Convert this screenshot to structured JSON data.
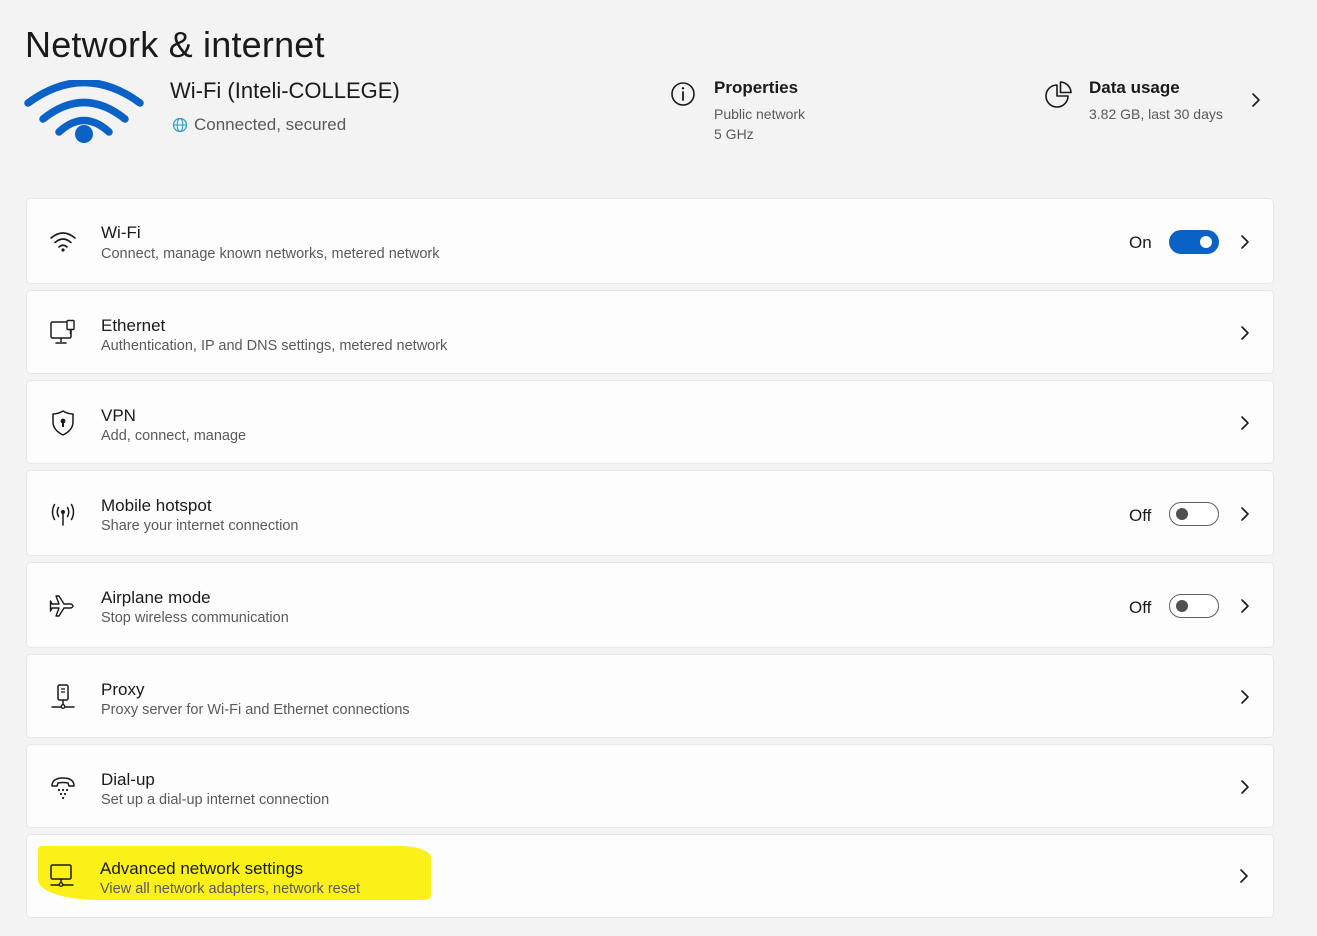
{
  "page": {
    "title": "Network & internet"
  },
  "header": {
    "connection_name": "Wi-Fi (Inteli-COLLEGE)",
    "connection_status": "Connected, secured",
    "properties": {
      "title": "Properties",
      "line1": "Public network",
      "line2": "5 GHz"
    },
    "data_usage": {
      "title": "Data usage",
      "detail": "3.82 GB, last 30 days"
    }
  },
  "items": [
    {
      "title": "Wi-Fi",
      "subtitle": "Connect, manage known networks, metered network",
      "state": "On",
      "icon": "wifi-icon"
    },
    {
      "title": "Ethernet",
      "subtitle": "Authentication, IP and DNS settings, metered network",
      "icon": "ethernet-icon"
    },
    {
      "title": "VPN",
      "subtitle": "Add, connect, manage",
      "icon": "vpn-shield-icon"
    },
    {
      "title": "Mobile hotspot",
      "subtitle": "Share your internet connection",
      "state": "Off",
      "icon": "hotspot-icon"
    },
    {
      "title": "Airplane mode",
      "subtitle": "Stop wireless communication",
      "state": "Off",
      "icon": "airplane-icon"
    },
    {
      "title": "Proxy",
      "subtitle": "Proxy server for Wi-Fi and Ethernet connections",
      "icon": "proxy-icon"
    },
    {
      "title": "Dial-up",
      "subtitle": "Set up a dial-up internet connection",
      "icon": "dialup-icon"
    },
    {
      "title": "Advanced network settings",
      "subtitle": "View all network adapters, network reset",
      "icon": "advanced-network-icon",
      "highlighted": true
    }
  ],
  "colors": {
    "accent": "#0a62c6",
    "highlight": "#fbf000",
    "background": "#f3f3f3",
    "card": "#fdfdfd"
  }
}
